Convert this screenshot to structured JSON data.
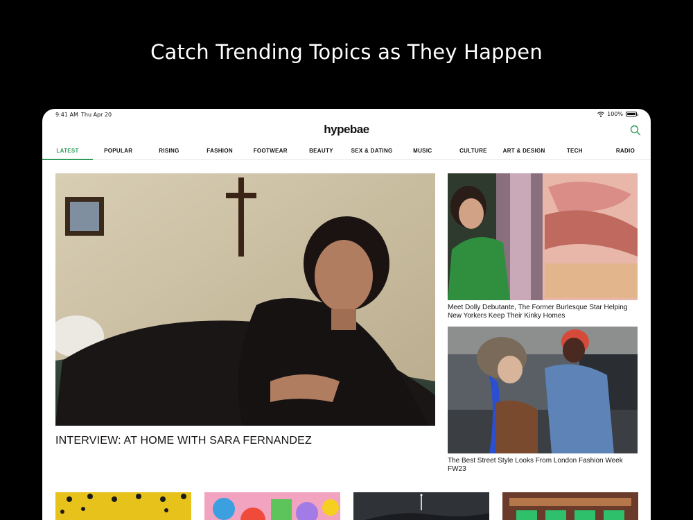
{
  "promo": {
    "headline": "Catch Trending Topics as They Happen"
  },
  "status_bar": {
    "time": "9:41 AM",
    "date": "Thu Apr 20",
    "battery": "100%"
  },
  "app": {
    "logo": "hypebae",
    "search_icon": "search-icon"
  },
  "nav": {
    "active_index": 0,
    "accent_color": "#2e9c5a",
    "items": [
      {
        "label": "LATEST"
      },
      {
        "label": "POPULAR"
      },
      {
        "label": "RISING"
      },
      {
        "label": "FASHION"
      },
      {
        "label": "FOOTWEAR"
      },
      {
        "label": "BEAUTY"
      },
      {
        "label": "SEX & DATING"
      },
      {
        "label": "MUSIC"
      },
      {
        "label": "CULTURE"
      },
      {
        "label": "ART & DESIGN"
      },
      {
        "label": "TECH"
      },
      {
        "label": "RADIO"
      }
    ]
  },
  "featured": {
    "title": "INTERVIEW: AT HOME WITH SARA FERNANDEZ"
  },
  "side_articles": [
    {
      "title": "Meet Dolly Debutante, The Former Burlesque Star Helping New Yorkers Keep Their Kinky Homes"
    },
    {
      "title": "The Best Street Style Looks From London Fashion Week FW23"
    }
  ]
}
